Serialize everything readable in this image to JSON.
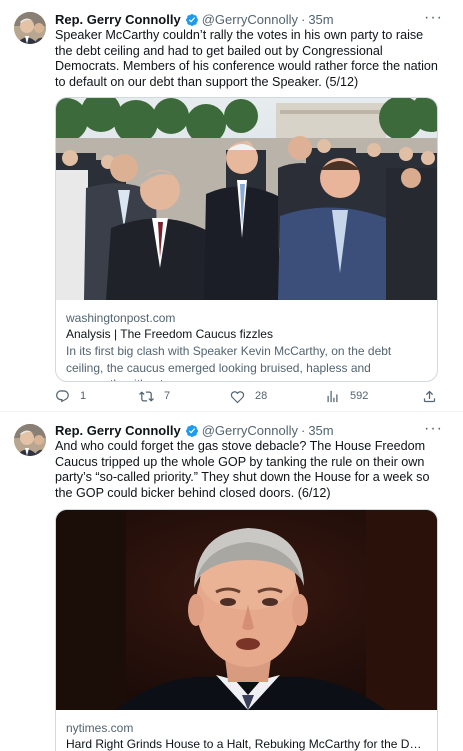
{
  "tweets": [
    {
      "author_name": "Rep. Gerry Connolly",
      "handle": "@GerryConnolly",
      "separator": "·",
      "time": "35m",
      "more_label": "···",
      "text": "Speaker McCarthy couldn’t rally the votes in his own party to raise the debt ceiling and had to get bailed out by Congressional Democrats. Members of his conference would rather force the nation to default on our debt than support the Speaker. (5/12)",
      "card": {
        "domain": "washingtonpost.com",
        "title": "Analysis | The Freedom Caucus fizzles",
        "description": "In its first big clash with Speaker Kevin McCarthy, on the debt ceiling, the caucus emerged looking bruised, hapless and apparently without…"
      },
      "actions": {
        "reply_count": "1",
        "retweet_count": "7",
        "like_count": "28",
        "views_count": "592"
      }
    },
    {
      "author_name": "Rep. Gerry Connolly",
      "handle": "@GerryConnolly",
      "separator": "·",
      "time": "35m",
      "more_label": "···",
      "text": "And who could forget the gas stove debacle? The House Freedom Caucus tripped up the whole GOP by tanking the rule on their own party’s “so-called priority.” They shut down the House for a week so the GOP could bicker behind closed doors. (6/12)",
      "card": {
        "domain": "nytimes.com",
        "title": "Hard Right Grinds House to a Halt, Rebuking McCarthy for the Debt D…"
      }
    }
  ],
  "colors": {
    "text_primary": "#0f1419",
    "text_secondary": "#536471",
    "verified_blue": "#1d9bf0",
    "border": "#cfd9de"
  },
  "icons": [
    "verified-badge-icon",
    "reply-icon",
    "retweet-icon",
    "like-icon",
    "views-icon",
    "share-icon",
    "more-icon"
  ]
}
